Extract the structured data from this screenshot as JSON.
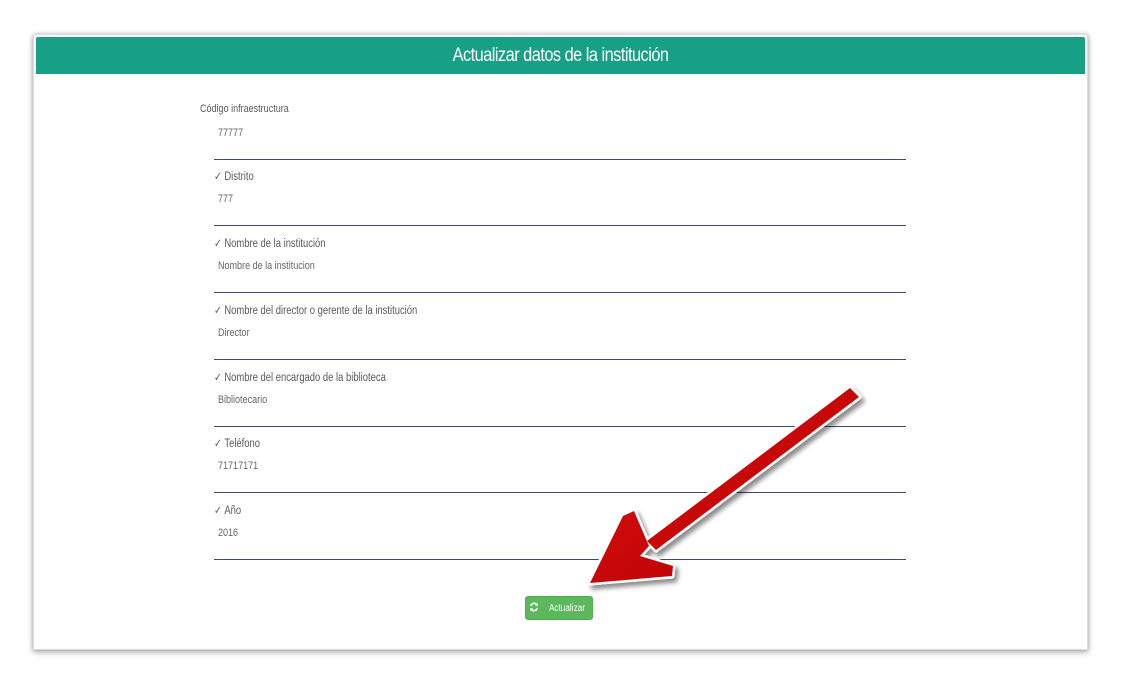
{
  "form": {
    "title": "Actualizar datos de la institución",
    "fields": [
      {
        "label": "Código infraestructura",
        "value": "77777",
        "check": ""
      },
      {
        "label": "Distrito",
        "value": "777",
        "check": "✓"
      },
      {
        "label": "Nombre de la institución",
        "value": "Nombre de la institucion",
        "check": "✓"
      },
      {
        "label": "Nombre del director o gerente de la institución",
        "value": "Director",
        "check": "✓"
      },
      {
        "label": "Nombre del encargado de la biblioteca",
        "value": "Bibliotecario",
        "check": "✓"
      },
      {
        "label": "Teléfono",
        "value": "71717171",
        "check": "✓"
      },
      {
        "label": "Año",
        "value": "2016",
        "check": "✓"
      }
    ],
    "submit_label": "Actualizar",
    "submit_icon": "refresh-icon"
  },
  "annotation": {
    "arrow_color": "#cc0000"
  }
}
